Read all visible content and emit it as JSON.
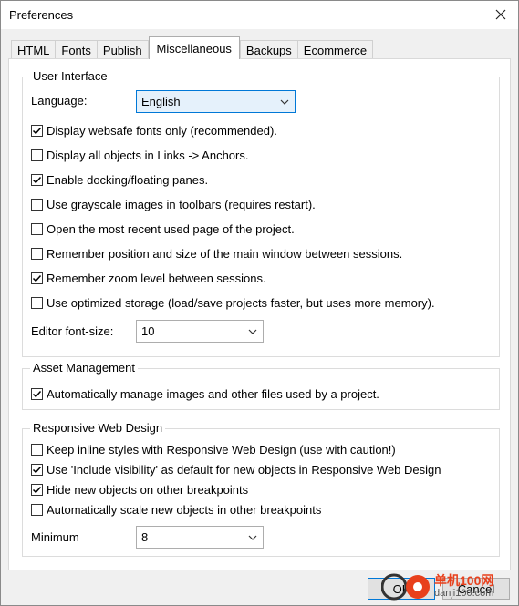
{
  "window": {
    "title": "Preferences"
  },
  "tabs": [
    {
      "label": "HTML",
      "active": false
    },
    {
      "label": "Fonts",
      "active": false
    },
    {
      "label": "Publish",
      "active": false
    },
    {
      "label": "Miscellaneous",
      "active": true
    },
    {
      "label": "Backups",
      "active": false
    },
    {
      "label": "Ecommerce",
      "active": false
    }
  ],
  "ui_group": {
    "title": "User Interface",
    "language_label": "Language:",
    "language_value": "English",
    "checkboxes": [
      {
        "label": "Display websafe fonts only (recommended).",
        "checked": true
      },
      {
        "label": "Display all objects in Links -> Anchors.",
        "checked": false
      },
      {
        "label": "Enable docking/floating panes.",
        "checked": true
      },
      {
        "label": "Use grayscale images in toolbars (requires restart).",
        "checked": false
      },
      {
        "label": "Open the most recent used page of the project.",
        "checked": false
      },
      {
        "label": "Remember position and size of the main window between sessions.",
        "checked": false
      },
      {
        "label": "Remember zoom level between sessions.",
        "checked": true
      },
      {
        "label": "Use optimized storage (load/save projects faster, but uses more memory).",
        "checked": false
      }
    ],
    "font_size_label": "Editor font-size:",
    "font_size_value": "10"
  },
  "asset_group": {
    "title": "Asset Management",
    "checkboxes": [
      {
        "label": "Automatically manage images and other files used by a project.",
        "checked": true
      }
    ]
  },
  "rwd_group": {
    "title": "Responsive Web Design",
    "checkboxes": [
      {
        "label": "Keep inline styles with Responsive Web Design (use with caution!)",
        "checked": false
      },
      {
        "label": "Use 'Include visibility' as default for new objects in Responsive Web Design",
        "checked": true
      },
      {
        "label": "Hide new objects on other breakpoints",
        "checked": true
      },
      {
        "label": "Automatically scale new objects in other breakpoints",
        "checked": false
      }
    ],
    "minimum_label": "Minimum",
    "minimum_value": "8"
  },
  "buttons": {
    "ok": "OK",
    "cancel": "Cancel"
  },
  "watermark": {
    "text1": "单机100网",
    "text2": "danji100.com"
  }
}
